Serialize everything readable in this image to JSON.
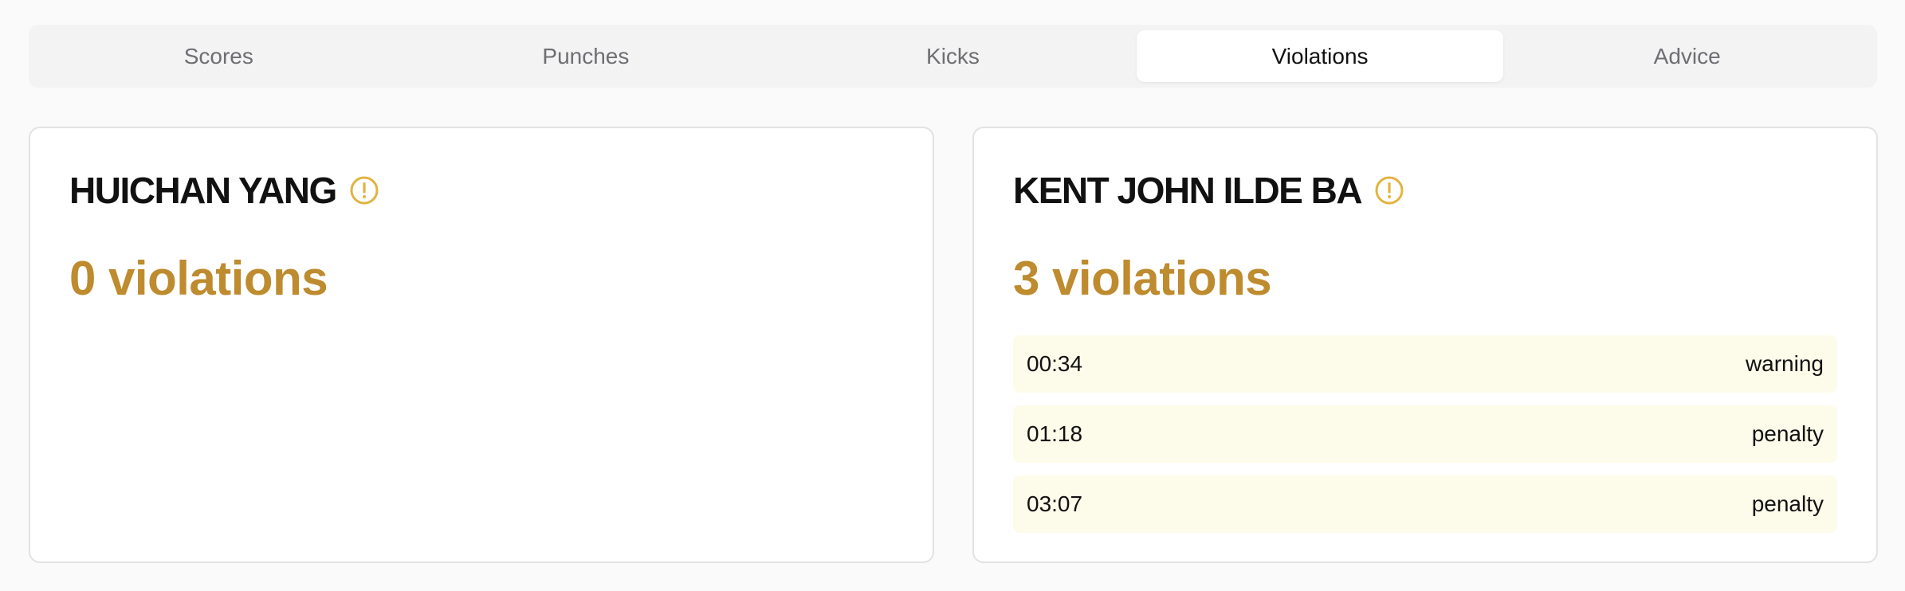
{
  "tabs": [
    {
      "label": "Scores",
      "active": false
    },
    {
      "label": "Punches",
      "active": false
    },
    {
      "label": "Kicks",
      "active": false
    },
    {
      "label": "Violations",
      "active": true
    },
    {
      "label": "Advice",
      "active": false
    }
  ],
  "colors": {
    "accent": "#be8b2f",
    "icon": "#e2b340",
    "row_bg": "#fdfbea"
  },
  "fighters": [
    {
      "name": "HUICHAN YANG",
      "icon": "warning-circle-icon",
      "violations_label": "0 violations",
      "violations": []
    },
    {
      "name": "KENT JOHN ILDE BA",
      "icon": "warning-circle-icon",
      "violations_label": "3 violations",
      "violations": [
        {
          "time": "00:34",
          "type": "warning"
        },
        {
          "time": "01:18",
          "type": "penalty"
        },
        {
          "time": "03:07",
          "type": "penalty"
        }
      ]
    }
  ]
}
